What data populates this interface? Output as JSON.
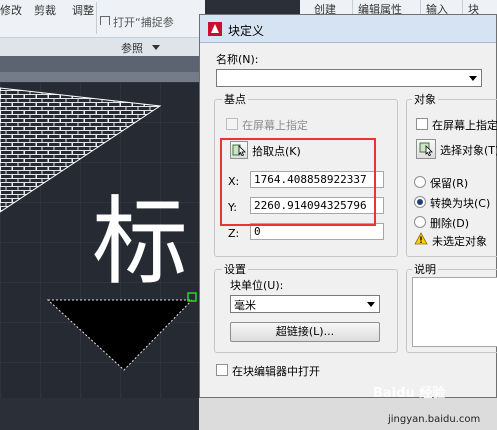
{
  "ribbon": {
    "items": [
      "修改",
      "剪裁",
      "调整"
    ],
    "insert_label": "打开“捕捉参",
    "panel_label": "参照",
    "right_items": [
      "创建",
      "编辑属性",
      "输入",
      "块"
    ]
  },
  "canvas": {
    "big_char": "标"
  },
  "dialog": {
    "title": "块定义",
    "name_label": "名称(N):",
    "name_value": "",
    "base_point": {
      "group_title": "基点",
      "specify_on_screen": "在屏幕上指定",
      "pick_point": "拾取点(K)",
      "x_label": "X:",
      "x_value": "1764.408858922337",
      "y_label": "Y:",
      "y_value": "2260.914094325796",
      "z_label": "Z:",
      "z_value": "0"
    },
    "objects": {
      "group_title": "对象",
      "specify_on_screen": "在屏幕上指定",
      "select_objects": "选择对象(T)",
      "retain": "保留(R)",
      "convert_to_block": "转换为块(C)",
      "delete": "删除(D)",
      "warning": "未选定对象"
    },
    "settings": {
      "group_title": "设置",
      "block_unit_label": "块单位(U):",
      "block_unit_value": "毫米",
      "hyperlink_button": "超链接(L)..."
    },
    "description": {
      "group_title": "说明"
    },
    "open_in_editor": "在块编辑器中打开"
  },
  "watermark": {
    "text": "Baidu 经验",
    "url": "jingyan.baidu.com"
  },
  "colors": {
    "highlight_box": "#e8352f",
    "title_bar": "#d6e3f2",
    "canvas_bg": "#252a33"
  }
}
